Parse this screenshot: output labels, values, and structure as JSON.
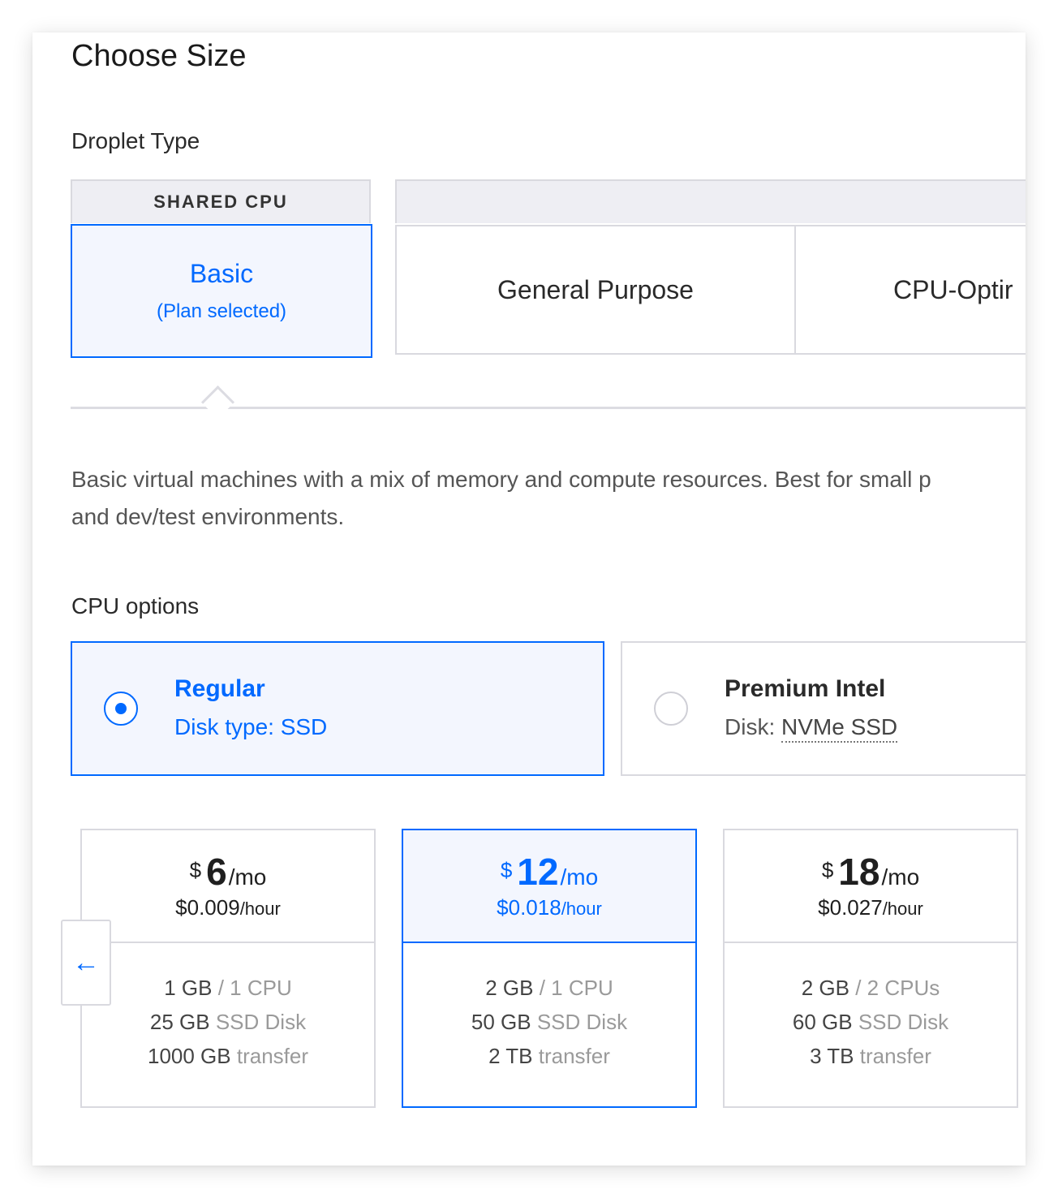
{
  "page_title": "Choose Size",
  "droplet_type": {
    "heading": "Droplet Type",
    "shared_header": "SHARED CPU",
    "dedicated_header": "",
    "basic": {
      "label": "Basic",
      "status": "(Plan selected)"
    },
    "general_purpose": "General Purpose",
    "cpu_optimized": "CPU-Optir"
  },
  "description": "Basic virtual machines with a mix of memory and compute resources. Best for small p",
  "description_line2": "and dev/test environments.",
  "cpu_options": {
    "heading": "CPU options",
    "regular": {
      "name": "Regular",
      "sub": "Disk type: SSD",
      "selected": true
    },
    "premium": {
      "name": "Premium Intel",
      "sub_prefix": "Disk: ",
      "sub_value": "NVMe SSD",
      "selected": false
    }
  },
  "plans": [
    {
      "currency": "$",
      "amount": "6",
      "per": "/mo",
      "hourly": "$0.009",
      "hourly_unit": "/hour",
      "memory": "1 GB",
      "cpu": "/ 1 CPU",
      "disk_size": "25 GB",
      "disk_label": "SSD Disk",
      "transfer_size": "1000 GB",
      "transfer_label": "transfer",
      "selected": false
    },
    {
      "currency": "$",
      "amount": "12",
      "per": "/mo",
      "hourly": "$0.018",
      "hourly_unit": "/hour",
      "memory": "2 GB",
      "cpu": "/ 1 CPU",
      "disk_size": "50 GB",
      "disk_label": "SSD Disk",
      "transfer_size": "2 TB",
      "transfer_label": "transfer",
      "selected": true
    },
    {
      "currency": "$",
      "amount": "18",
      "per": "/mo",
      "hourly": "$0.027",
      "hourly_unit": "/hour",
      "memory": "2 GB",
      "cpu": "/ 2 CPUs",
      "disk_size": "60 GB",
      "disk_label": "SSD Disk",
      "transfer_size": "3 TB",
      "transfer_label": "transfer",
      "selected": false
    }
  ],
  "scroll_left_icon": "arrow-left-icon",
  "scroll_left_glyph": "←",
  "colors": {
    "accent": "#0069ff",
    "selected_bg": "#f3f6fe",
    "border": "#d9d9df"
  }
}
